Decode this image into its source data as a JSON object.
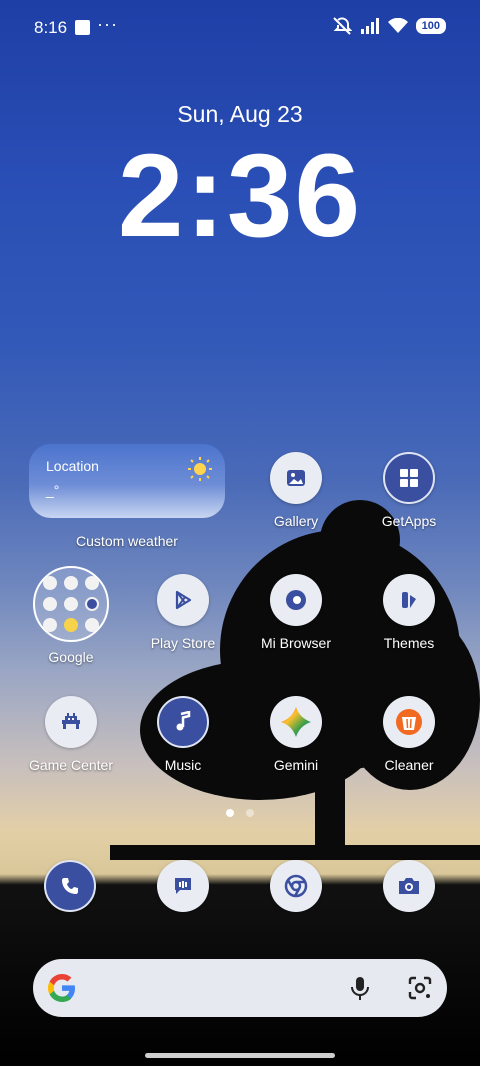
{
  "status_bar": {
    "time": "8:16",
    "more": "···",
    "battery": "100"
  },
  "lockscreen": {
    "date": "Sun, Aug 23",
    "clock": "2:36"
  },
  "weather_widget": {
    "location": "Location",
    "temp": "_°",
    "caption": "Custom weather"
  },
  "apps": {
    "gallery": "Gallery",
    "getapps": "GetApps",
    "google": "Google",
    "playstore": "Play Store",
    "mibrowser": "Mi Browser",
    "themes": "Themes",
    "gamecenter": "Game Center",
    "music": "Music",
    "gemini": "Gemini",
    "cleaner": "Cleaner"
  },
  "dock": [
    "phone-icon",
    "messages-icon",
    "chrome-icon",
    "camera-icon"
  ],
  "colors": {
    "accent": "#3a4fa0",
    "icon_bg": "#e9ecf3"
  }
}
